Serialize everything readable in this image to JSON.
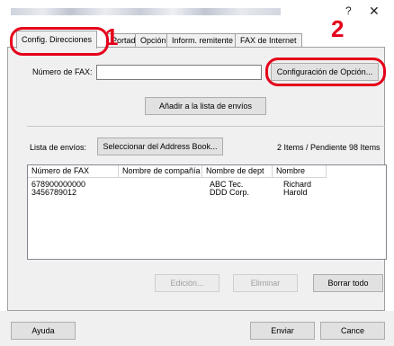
{
  "window": {
    "help_glyph": "?",
    "close_glyph": "✕"
  },
  "tabs": [
    {
      "label": "Config. Direcciones"
    },
    {
      "label": "Portada"
    },
    {
      "label": "Opción"
    },
    {
      "label": "Inform. remitente"
    },
    {
      "label": "FAX de Internet"
    }
  ],
  "fax": {
    "number_label": "Número de FAX:",
    "number_value": "",
    "option_button": "Configuración de Opción...",
    "add_button": "Añadir a la lista de envíos"
  },
  "send_list": {
    "label": "Lista de envíos:",
    "address_book_button": "Seleccionar del Address Book...",
    "status": "2 Items / Pendiente 98 Items",
    "columns": [
      "Número de FAX",
      "Nombre de compañía",
      "Nombre de dept",
      "Nombre"
    ],
    "rows": [
      {
        "fax": "678900000000",
        "company": "",
        "dept": "ABC Tec.",
        "name": "Richard"
      },
      {
        "fax": "3456789012",
        "company": "",
        "dept": "DDD Corp.",
        "name": "Harold"
      }
    ]
  },
  "list_actions": {
    "edit": "Edición...",
    "delete": "Eliminar",
    "delete_all": "Borrar todo"
  },
  "footer": {
    "help": "Ayuda",
    "send": "Enviar",
    "cancel": "Cance"
  },
  "callouts": {
    "one": "1",
    "two": "2"
  },
  "colors": {
    "highlight": "#e5001a",
    "panel": "#f0f0f0"
  }
}
